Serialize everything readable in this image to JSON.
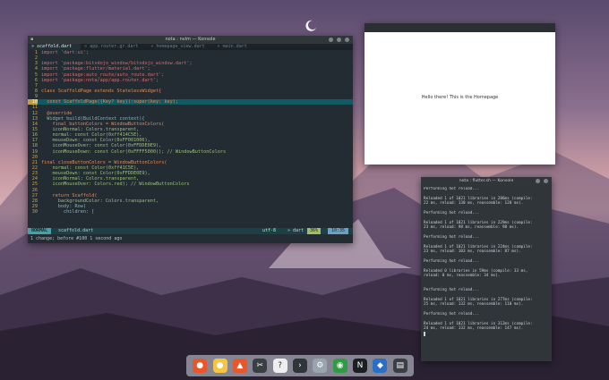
{
  "editor": {
    "title": "nota : nvim — Konsole",
    "tabs": [
      {
        "label": "scaffold.dart",
        "active": true
      },
      {
        "label": "app.router.gr.dart",
        "active": false
      },
      {
        "label": "homepage_view.dart",
        "active": false
      },
      {
        "label": "main.dart",
        "active": false
      }
    ],
    "status": {
      "mode": "NORMAL",
      "file": "scaffold.dart",
      "encoding": "utf-8",
      "filetype": "dart",
      "percent": "36%",
      "position": "10:35"
    },
    "message": "1 change; before #100  1 second ago"
  },
  "code_lines": [
    {
      "no": "1",
      "text": "import 'dart:ui';"
    },
    {
      "no": "2",
      "text": ""
    },
    {
      "no": "3",
      "text": "import 'package:bitsdojo_window/bitsdojo_window.dart';"
    },
    {
      "no": "4",
      "text": "import 'package:flutter/material.dart';"
    },
    {
      "no": "5",
      "text": "import 'package:auto_route/auto_route.dart';"
    },
    {
      "no": "6",
      "text": "import 'package:nota/app/app.router.dart';"
    },
    {
      "no": "7",
      "text": ""
    },
    {
      "no": "8",
      "text": "class ScaffoldPage extends StatelessWidget{"
    },
    {
      "no": "9",
      "text": ""
    },
    {
      "no": "10",
      "text": "  const ScaffoldPage({Key? key}):super(key: key);"
    },
    {
      "no": "11",
      "text": ""
    },
    {
      "no": "12",
      "text": "  @override"
    },
    {
      "no": "13",
      "text": "  Widget build(BuildContext context){"
    },
    {
      "no": "14",
      "text": "    final buttonColors = WindowButtonColors("
    },
    {
      "no": "15",
      "text": "    iconNormal: Colors.transparent,"
    },
    {
      "no": "16",
      "text": "    normal: const Color(0xff414C5E),"
    },
    {
      "no": "17",
      "text": "    mouseDown: const Color(0xFF001006),"
    },
    {
      "no": "18",
      "text": "    iconMouseOver: const Color(0xFFDDE0E9),"
    },
    {
      "no": "19",
      "text": "    iconMouseDown: const Color(0xFFFF5000)); // WindowButtonColors"
    },
    {
      "no": "20",
      "text": ""
    },
    {
      "no": "21",
      "text": "final closeButtonColors = WindowButtonColors("
    },
    {
      "no": "22",
      "text": "    normal: const Color(0xff41C5E),"
    },
    {
      "no": "23",
      "text": "    mouseDown: const Color(0xFFDDE0E9),"
    },
    {
      "no": "24",
      "text": "    iconNormal: Colors.transparent,"
    },
    {
      "no": "25",
      "text": "    iconMouseOver: Colors.red); // WindowButtonColors"
    },
    {
      "no": "26",
      "text": ""
    },
    {
      "no": "27",
      "text": "    return Scaffold("
    },
    {
      "no": "28",
      "text": "      backgroundColor: Colors.transparent,"
    },
    {
      "no": "29",
      "text": "      body: Row("
    },
    {
      "no": "30",
      "text": "        children: ["
    }
  ],
  "browser": {
    "message": "Hello there! This is the Homepage"
  },
  "terminal": {
    "title": "nota : flutter.sh — Konsole",
    "lines": [
      "Performing hot reload...",
      "",
      "Reloaded 1 of 1021 libraries in 286ms (compile:",
      "22 ms, reload: 130 ms, reassemble: 120 ms).",
      "",
      "Performing hot reload...",
      "",
      "Reloaded 1 of 1021 libraries in 229ms (compile:",
      "23 ms, reload: 98 ms, reassemble: 98 ms).",
      "",
      "Performing hot reload...",
      "",
      "Reloaded 1 of 1021 libraries in 224ms (compile:",
      "23 ms, reload: 103 ms, reassemble: 87 ms).",
      "",
      "Performing hot reload...",
      "",
      "Reloaded 0 libraries in 59ms (compile: 33 ms,",
      "reload: 0 ms, reassemble: 34 ms).",
      "",
      "",
      "Performing hot reload...",
      "",
      "Reloaded 1 of 1021 libraries in 277ms (compile:",
      "25 ms, reload: 132 ms, reassemble: 110 ms).",
      "",
      "Performing hot reload...",
      "",
      "Reloaded 1 of 1021 libraries in 312ms (compile:",
      "24 ms, reload: 132 ms, reassemble: 147 ms)."
    ]
  },
  "dock": [
    {
      "name": "firefox-icon",
      "color": "#e8562a",
      "glyph": "●"
    },
    {
      "name": "notes-icon",
      "color": "#f4c542",
      "glyph": "●"
    },
    {
      "name": "office-icon",
      "color": "#e8562a",
      "glyph": "▲"
    },
    {
      "name": "tools-icon",
      "color": "#3a3f44",
      "glyph": "✂"
    },
    {
      "name": "help-icon",
      "color": "#eeeeee",
      "glyph": "?"
    },
    {
      "name": "terminal-icon",
      "color": "#2f3539",
      "glyph": "›"
    },
    {
      "name": "settings-icon",
      "color": "#9aa4ad",
      "glyph": "⚙"
    },
    {
      "name": "chrome-icon",
      "color": "#2f9b45",
      "glyph": "◉"
    },
    {
      "name": "neovim-icon",
      "color": "#1c1f22",
      "glyph": "N"
    },
    {
      "name": "vscode-icon",
      "color": "#2b6fc4",
      "glyph": "◆"
    },
    {
      "name": "files-icon",
      "color": "#3a3f44",
      "glyph": "▤"
    }
  ]
}
